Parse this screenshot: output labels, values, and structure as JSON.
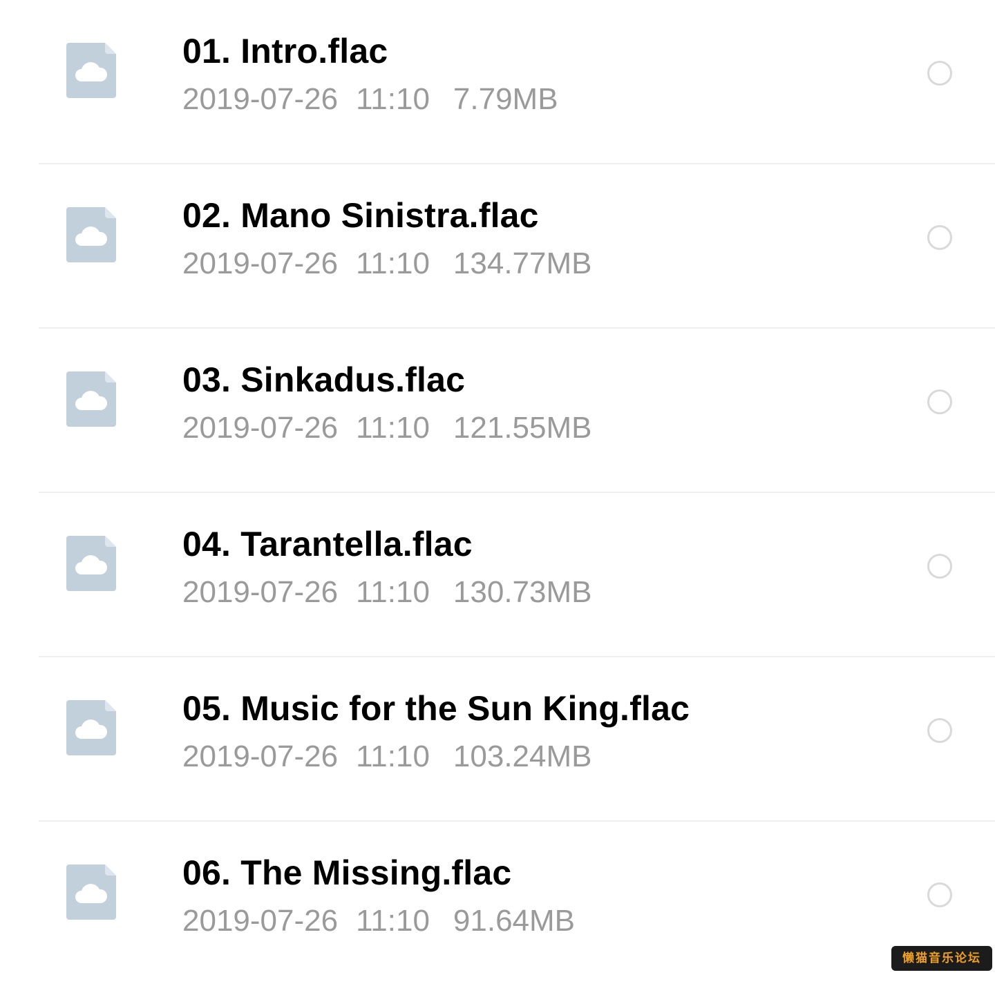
{
  "colors": {
    "title": "#000000",
    "meta": "#9a9a9a",
    "icon": "#c2d0dc",
    "icon_cloud": "#ffffff",
    "radio": "#d9d9d9",
    "divider": "#efefef",
    "watermark_bg": "#1c1c1c",
    "watermark_text": "#f0a020"
  },
  "icons": {
    "file": "cloud-file-icon",
    "select": "radio-unchecked"
  },
  "files": [
    {
      "name": "01. Intro.flac",
      "date": "2019-07-26",
      "time": "11:10",
      "size": "7.79MB"
    },
    {
      "name": "02. Mano Sinistra.flac",
      "date": "2019-07-26",
      "time": "11:10",
      "size": "134.77MB"
    },
    {
      "name": "03. Sinkadus.flac",
      "date": "2019-07-26",
      "time": "11:10",
      "size": "121.55MB"
    },
    {
      "name": "04. Tarantella.flac",
      "date": "2019-07-26",
      "time": "11:10",
      "size": "130.73MB"
    },
    {
      "name": "05. Music for the Sun King.flac",
      "date": "2019-07-26",
      "time": "11:10",
      "size": "103.24MB"
    },
    {
      "name": "06. The Missing.flac",
      "date": "2019-07-26",
      "time": "11:10",
      "size": "91.64MB"
    }
  ],
  "watermark": "懒猫音乐论坛"
}
